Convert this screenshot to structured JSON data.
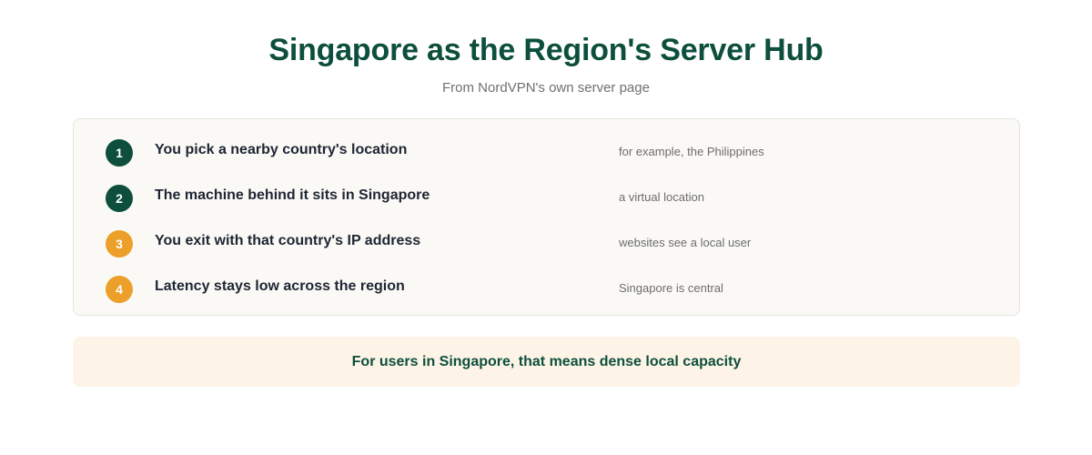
{
  "header": {
    "title": "Singapore as the Region's Server Hub",
    "subtitle": "From NordVPN's own server page"
  },
  "steps": [
    {
      "number": "1",
      "text": "You pick a nearby country's location",
      "note": "for example, the Philippines",
      "badge_color": "#0d4f3c"
    },
    {
      "number": "2",
      "text": "The machine behind it sits in Singapore",
      "note": "a virtual location",
      "badge_color": "#0d4f3c"
    },
    {
      "number": "3",
      "text": "You exit with that country's IP address",
      "note": "websites see a local user",
      "badge_color": "#eca02a"
    },
    {
      "number": "4",
      "text": "Latency stays low across the region",
      "note": "Singapore is central",
      "badge_color": "#eca02a"
    }
  ],
  "callout": {
    "text": "For users in Singapore, that means dense local capacity"
  },
  "colors": {
    "primary": "#0d4f3c",
    "accent": "#eca02a",
    "callout_bg": "#fdf3e7"
  }
}
